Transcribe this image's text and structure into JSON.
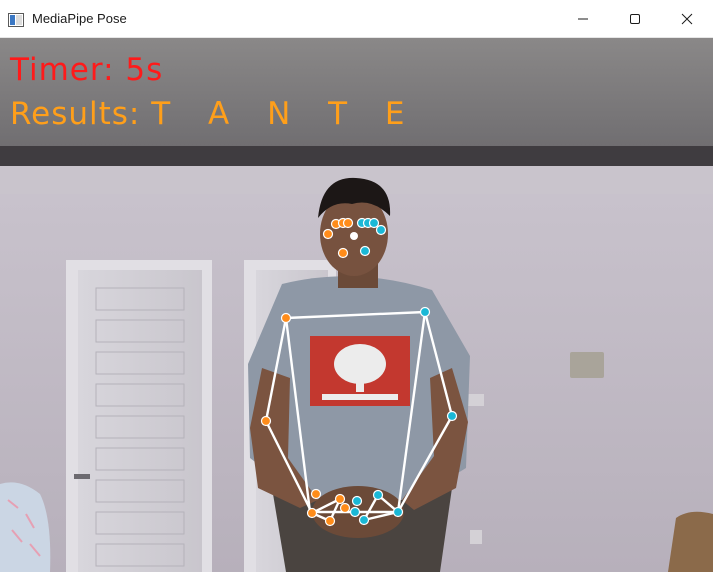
{
  "window": {
    "title": "MediaPipe Pose",
    "minimize_icon": "minimize-icon",
    "maximize_icon": "maximize-icon",
    "close_icon": "close-icon"
  },
  "overlay": {
    "timer_label": "Timer:",
    "timer_value": "5s",
    "timer_color": "#ff1a1a",
    "results_label": "Results:",
    "results_value": "T A N T E",
    "results_color": "#ff9f1a"
  },
  "colors": {
    "left_landmark": "#ff8c1a",
    "right_landmark": "#1ab8d6",
    "connection": "#ffffff"
  }
}
